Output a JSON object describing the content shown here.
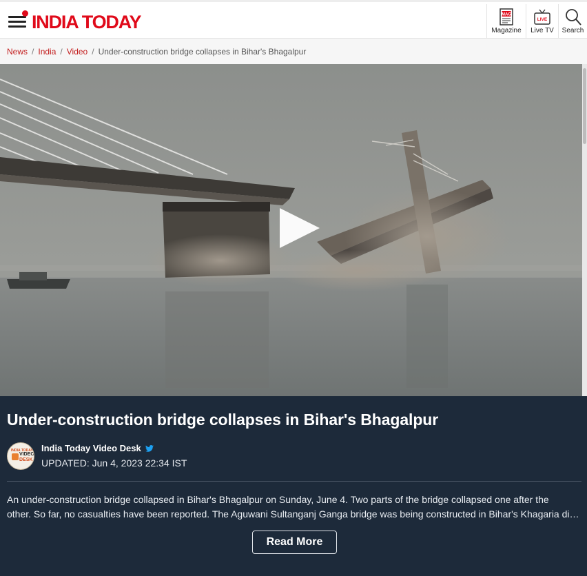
{
  "header": {
    "logo_text": "INDIA TODAY",
    "menu_icon": "hamburger-menu-icon",
    "buttons": [
      {
        "label": "Magazine",
        "icon": "magazine-icon",
        "icon_text": "MAG"
      },
      {
        "label": "Live TV",
        "icon": "live-tv-icon",
        "icon_text": "LIVE"
      },
      {
        "label": "Search",
        "icon": "search-icon"
      }
    ]
  },
  "breadcrumb": {
    "items": [
      "News",
      "India",
      "Video"
    ],
    "separator": "/",
    "current": "Under-construction bridge collapses in Bihar's Bhagalpur"
  },
  "video": {
    "play_icon": "play-icon"
  },
  "article": {
    "title": "Under-construction bridge collapses in Bihar's Bhagalpur",
    "author": "India Today Video Desk",
    "author_icon": "twitter-icon",
    "updated": "UPDATED: Jun 4, 2023 22:34 IST",
    "avatar_text": {
      "top": "INDIA TODAY",
      "line1": "VIDEO",
      "line2": "DESK"
    },
    "summary_line1": "An under-construction bridge collapsed in Bihar's Bhagalpur on Sunday, June 4. Two parts of the bridge collapsed one after the",
    "summary_line2": "other. So far, no casualties have been reported. The Aguwani Sultanganj Ganga bridge was being constructed in Bihar's Khagaria district.",
    "read_more_label": "Read More"
  },
  "colors": {
    "brand_red": "#e00a1a",
    "breadcrumb_link": "#c21b1b",
    "panel_bg": "#1d2a3a"
  }
}
